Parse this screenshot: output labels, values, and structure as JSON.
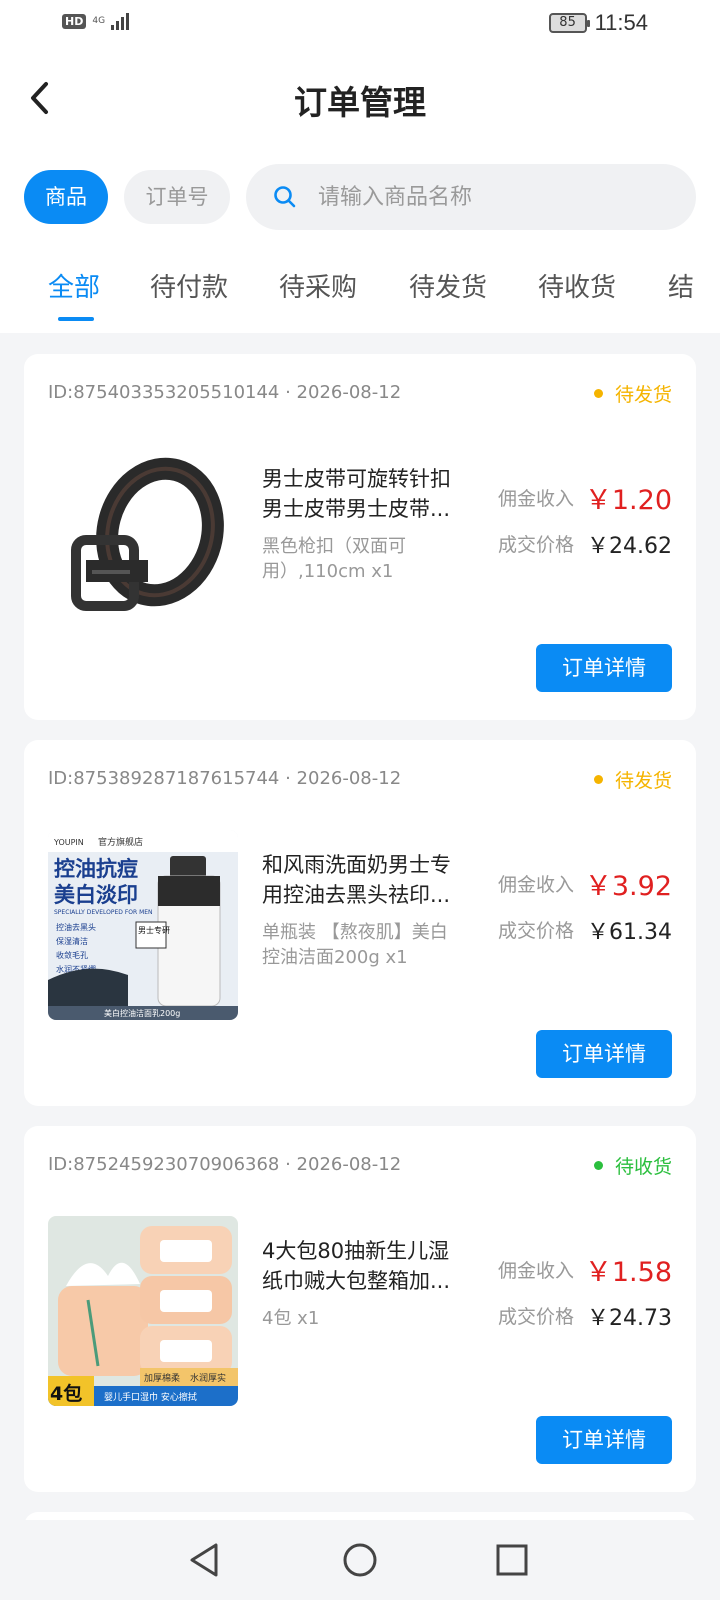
{
  "status_bar": {
    "hd": "HD",
    "network": "4G",
    "battery": "85",
    "time": "11:54"
  },
  "header": {
    "title": "订单管理"
  },
  "search": {
    "type_goods": "商品",
    "type_order": "订单号",
    "placeholder": "请输入商品名称",
    "value": ""
  },
  "tabs": [
    {
      "label": "全部",
      "active": true
    },
    {
      "label": "待付款"
    },
    {
      "label": "待采购"
    },
    {
      "label": "待发货"
    },
    {
      "label": "待收货"
    },
    {
      "label": "结"
    }
  ],
  "labels": {
    "commission": "佣金收入",
    "price": "成交价格",
    "detail_button": "订单详情"
  },
  "orders": [
    {
      "id_date": "ID:875403353205510144 · 2026-08-12",
      "status": "待发货",
      "status_color": "#f5b400",
      "name_line1": "男士皮带可旋转针扣",
      "name_line2": "男士皮带男士皮带...",
      "spec": "黑色枪扣（双面可用）,110cm x1",
      "commission": "￥1.20",
      "price": "￥24.62",
      "image": "belt-image"
    },
    {
      "id_date": "ID:875389287187615744 · 2026-08-12",
      "status": "待发货",
      "status_color": "#f5b400",
      "name_line1": "和风雨洗面奶男士专",
      "name_line2": "用控油去黑头祛印...",
      "spec": "单瓶装 【熬夜肌】美白控油洁面200g x1",
      "commission": "￥3.92",
      "price": "￥61.34",
      "image": "cleanser-image",
      "image_text": {
        "top_logo": "YOUPIN",
        "shop": "官方旗舰店",
        "line1": "控油抗痘",
        "line2": "美白淡印",
        "en": "SPECIALLY DEVELOPED FOR MEN",
        "bullets": [
          "控油去黑头",
          "保湿清洁",
          "收敛毛孔",
          "水润不紧绷"
        ],
        "badge": "男士专研",
        "bottom": "美白控油洁面乳200g"
      }
    },
    {
      "id_date": "ID:875245923070906368 · 2026-08-12",
      "status": "待收货",
      "status_color": "#2bbf3e",
      "name_line1": "4大包80抽新生儿湿",
      "name_line2": "纸巾贼大包整箱加...",
      "spec": "4包 x1",
      "commission": "￥1.58",
      "price": "￥24.73",
      "image": "wipes-image",
      "image_text": {
        "count": "4包",
        "tag1": "加厚棉柔",
        "tag2": "水润厚实",
        "bottom": "婴儿手口湿巾 安心擦拭"
      }
    }
  ],
  "colors": {
    "accent": "#0a8bf4",
    "commission": "#e02020",
    "background": "#f4f5f7"
  }
}
